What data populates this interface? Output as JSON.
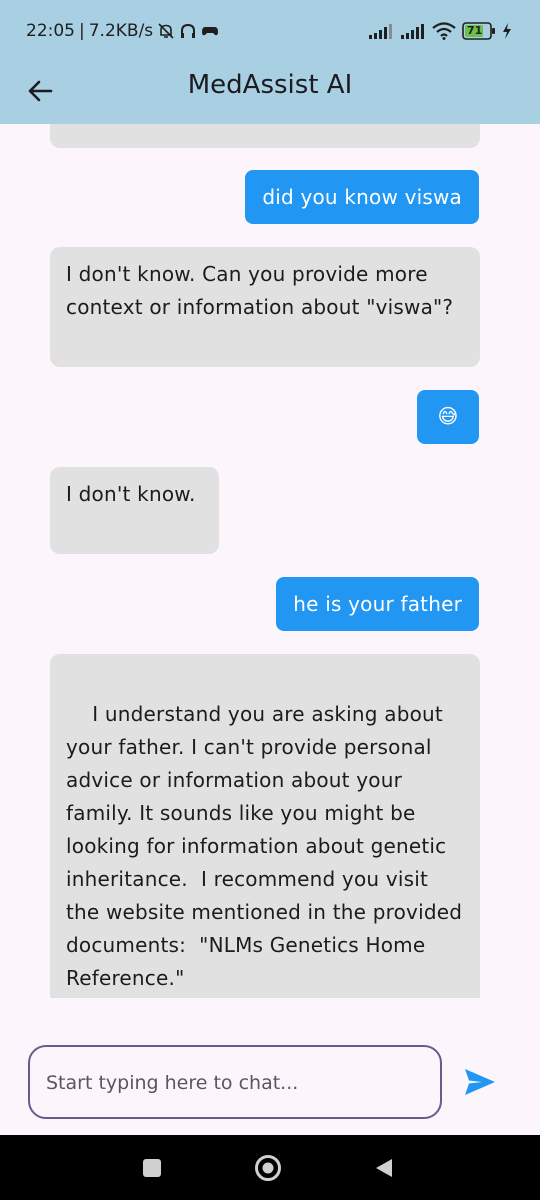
{
  "status_bar": {
    "time": "22:05",
    "separator": "|",
    "network_speed": "7.2KB/s",
    "battery_level": "71",
    "icons": [
      "bell-off-icon",
      "headphones-icon",
      "game-controller-icon",
      "cellular-signal-icon",
      "wifi-icon",
      "battery-icon",
      "charging-icon"
    ]
  },
  "app_bar": {
    "title": "MedAssist AI",
    "back_icon": "arrow-left-icon"
  },
  "messages": [
    {
      "sender": "bot",
      "text": ""
    },
    {
      "sender": "user",
      "text": "did you know viswa"
    },
    {
      "sender": "bot",
      "text": "I don't know. Can you provide more context or information about \"viswa\"?"
    },
    {
      "sender": "user",
      "text": "😅"
    },
    {
      "sender": "bot",
      "text": "I don't know."
    },
    {
      "sender": "user",
      "text": "he is your father"
    },
    {
      "sender": "bot",
      "text": "I understand you are asking about your father. I can't provide personal advice or information about your family. It sounds like you might be looking for information about genetic inheritance.  I recommend you visit the website mentioned in the provided documents:  \"NLMs Genetics Home Reference.\""
    }
  ],
  "composer": {
    "placeholder": "Start typing here to chat...",
    "value": "",
    "send_icon": "send-icon"
  },
  "colors": {
    "app_bar": "#a8cfe2",
    "user_bubble": "#2196f3",
    "bot_bubble": "#e1e1e1",
    "background": "#fcf6fc",
    "input_border": "#6b5a8e"
  }
}
